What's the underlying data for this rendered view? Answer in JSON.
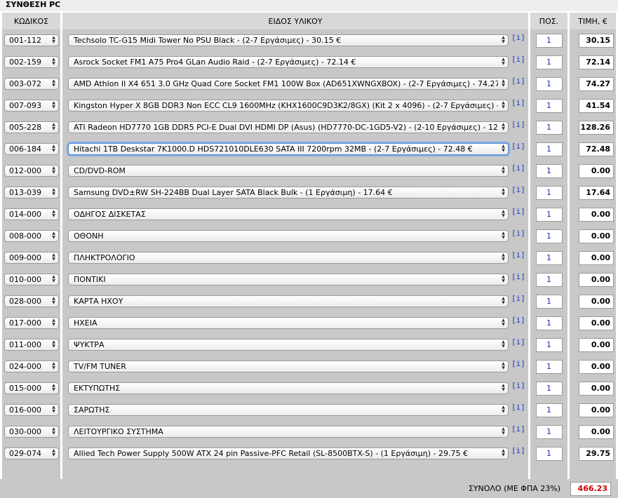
{
  "title": "ΣΥΝΘΕΣΗ PC",
  "headers": {
    "code": "ΚΩΔΙΚΟΣ",
    "item": "ΕΙΔΟΣ ΥΛΙΚΟΥ",
    "qty": "ΠΟΣ.",
    "price": "ΤΙΜΗ, €"
  },
  "info_label": "[i]",
  "rows": [
    {
      "code": "001-112",
      "desc": "Techsolo TC-G15 Midi Tower No PSU Black - (2-7 Εργάσιμες) - 30.15 €",
      "qty": "1",
      "price": "30.15"
    },
    {
      "code": "002-159",
      "desc": "Asrock Socket FM1 A75 Pro4 GLan Audio Raid - (2-7 Εργάσιμες) - 72.14 €",
      "qty": "1",
      "price": "72.14"
    },
    {
      "code": "003-072",
      "desc": "AMD Athlon II X4 651 3.0 GHz Quad Core Socket FM1 100W Box (AD651XWNGXBOX) - (2-7 Εργάσιμες) - 74.27",
      "qty": "1",
      "price": "74.27"
    },
    {
      "code": "007-093",
      "desc": "Kingston Hyper X 8GB DDR3 Non ECC CL9 1600MHz (KHX1600C9D3K2/8GX) (Kit 2 x 4096) - (2-7 Εργάσιμες) -",
      "qty": "1",
      "price": "41.54"
    },
    {
      "code": "005-228",
      "desc": "ATI Radeon HD7770 1GB DDR5 PCI-E Dual DVI HDMI DP (Asus) (HD7770-DC-1GD5-V2) - (2-10 Εργάσιμες) - 12",
      "qty": "1",
      "price": "128.26"
    },
    {
      "code": "006-184",
      "desc": "Hitachi 1TB Deskstar 7K1000.D HDS721010DLE630 SATA III 7200rpm 32MB - (2-7 Εργάσιμες) - 72.48 €",
      "qty": "1",
      "price": "72.48"
    },
    {
      "code": "012-000",
      "desc": "CD/DVD-ROM",
      "qty": "1",
      "price": "0.00"
    },
    {
      "code": "013-039",
      "desc": "Samsung DVD±RW SH-224BB Dual Layer SATA Black Bulk - (1 Εργάσιμη) - 17.64 €",
      "qty": "1",
      "price": "17.64"
    },
    {
      "code": "014-000",
      "desc": "ΟΔΗΓΟΣ ΔΙΣΚΕΤΑΣ",
      "qty": "1",
      "price": "0.00"
    },
    {
      "code": "008-000",
      "desc": "ΟΘΟΝΗ",
      "qty": "1",
      "price": "0.00"
    },
    {
      "code": "009-000",
      "desc": "ΠΛΗΚΤΡΟΛΟΓΙΟ",
      "qty": "1",
      "price": "0.00"
    },
    {
      "code": "010-000",
      "desc": "ΠΟΝΤΙΚΙ",
      "qty": "1",
      "price": "0.00"
    },
    {
      "code": "028-000",
      "desc": "ΚΑΡΤΑ ΗΧΟΥ",
      "qty": "1",
      "price": "0.00"
    },
    {
      "code": "017-000",
      "desc": "ΗΧΕΙΑ",
      "qty": "1",
      "price": "0.00"
    },
    {
      "code": "011-000",
      "desc": "ΨΥΚΤΡΑ",
      "qty": "1",
      "price": "0.00"
    },
    {
      "code": "024-000",
      "desc": "TV/FM TUNER",
      "qty": "1",
      "price": "0.00"
    },
    {
      "code": "015-000",
      "desc": "ΕΚΤΥΠΩΤΗΣ",
      "qty": "1",
      "price": "0.00"
    },
    {
      "code": "016-000",
      "desc": "ΣΑΡΩΤΗΣ",
      "qty": "1",
      "price": "0.00"
    },
    {
      "code": "030-000",
      "desc": "ΛΕΙΤΟΥΡΓΙΚΟ ΣΥΣΤΗΜΑ",
      "qty": "1",
      "price": "0.00"
    },
    {
      "code": "029-074",
      "desc": "Allied Tech Power Supply 500W ATX 24 pin Passive-PFC Retail (SL-8500BTX-S) - (1 Εργάσιμη) - 29.75 €",
      "qty": "1",
      "price": "29.75"
    }
  ],
  "focused_row": 5,
  "total": {
    "label": "ΣΥΝΟΛΟ (ΜΕ ΦΠΑ 23%)",
    "value": "466.23"
  },
  "colors": {
    "total_value": "#d10000",
    "qty_text": "#1a2fb0",
    "info_link": "#1a3fbf",
    "cell_bg": "#c8c8c8"
  }
}
